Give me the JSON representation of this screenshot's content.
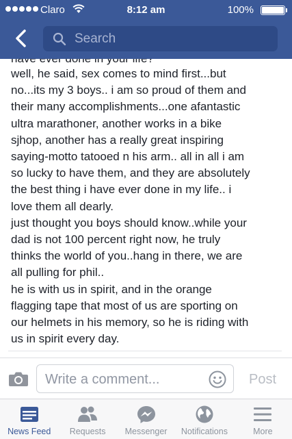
{
  "status_bar": {
    "carrier": "Claro",
    "time": "8:12 am",
    "battery": "100%"
  },
  "nav": {
    "search_placeholder": "Search"
  },
  "post": {
    "cut_off_line": "have ever done in your life?",
    "lines": [
      "well, he said, sex comes to mind first...but",
      "no...its my 3 boys.. i am so proud of them and",
      "their many accomplishments...one afantastic",
      "ultra marathoner, another works in a bike",
      "sjhop, another has a really great inspiring",
      "saying-motto tatooed n his arm.. all in all i am",
      "so lucky to have them, and they are absolutely",
      "the best thing i have ever done in my life.. i",
      "love them all dearly.",
      "just thought you boys should know..while your",
      "dad is not 100 percent right now, he truly",
      "thinks the world of you..hang in there, we are",
      "all pulling for phil..",
      "he is with us in spirit, and in the orange",
      "flagging tape that most of us are sporting on",
      "our helmets in his memory, so he is riding with",
      "us in spirit every day."
    ]
  },
  "comment_bar": {
    "placeholder": "Write a comment...",
    "post_label": "Post"
  },
  "tabs": [
    {
      "label": "News Feed",
      "icon": "news-feed-icon",
      "active": true
    },
    {
      "label": "Requests",
      "icon": "friend-requests-icon",
      "active": false
    },
    {
      "label": "Messenger",
      "icon": "messenger-icon",
      "active": false
    },
    {
      "label": "Notifications",
      "icon": "globe-icon",
      "active": false
    },
    {
      "label": "More",
      "icon": "menu-icon",
      "active": false
    }
  ],
  "colors": {
    "brand": "#3b5998",
    "tab_inactive": "#8d949e",
    "post_disabled": "#b9bdc4"
  }
}
